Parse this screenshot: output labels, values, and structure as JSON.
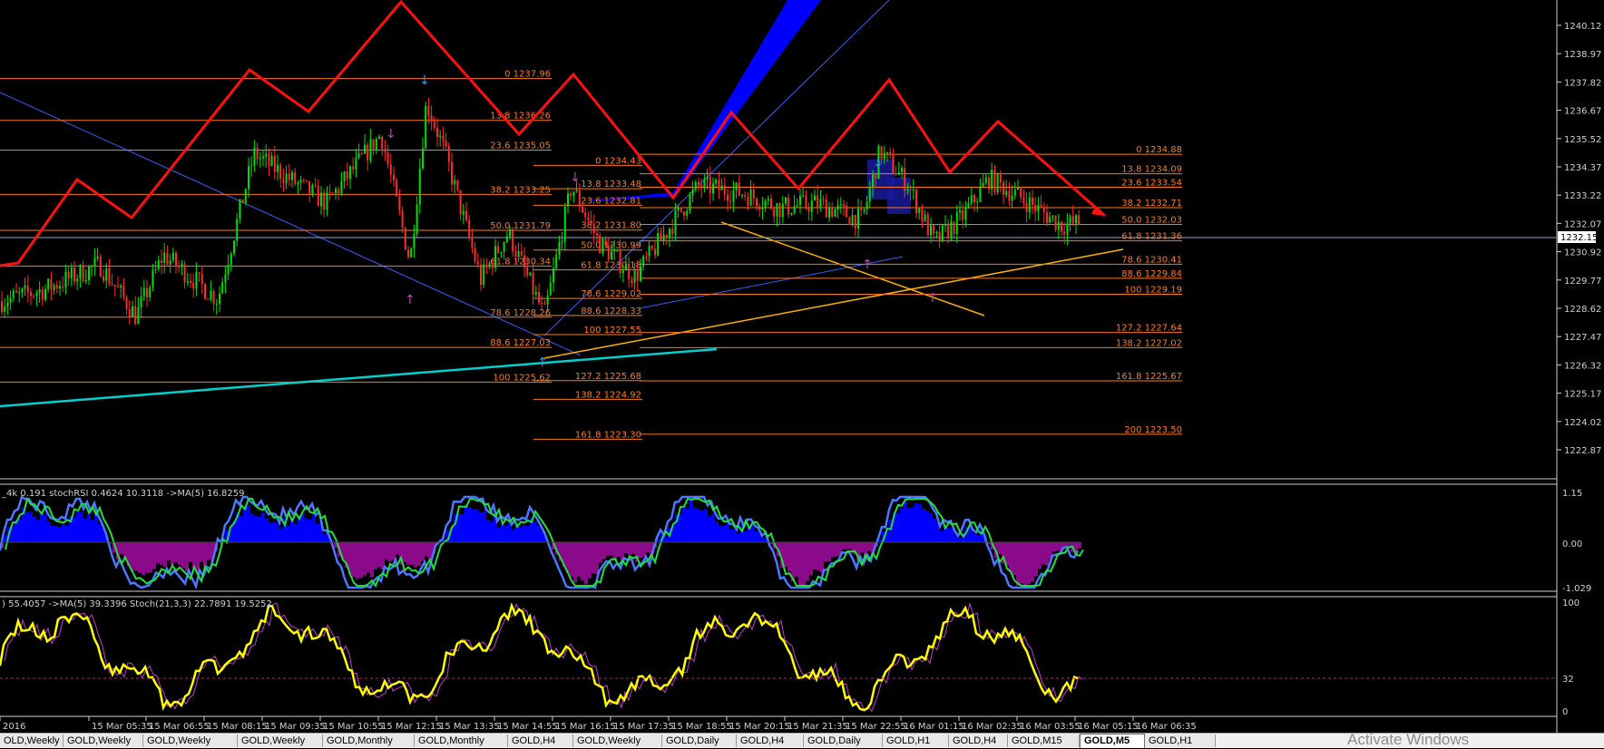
{
  "main_chart": {
    "price_ticks": [
      "1240.12",
      "1238.97",
      "1237.82",
      "1236.67",
      "1235.52",
      "1234.37",
      "1233.22",
      "1232.07",
      "1230.92",
      "1229.77",
      "1228.62",
      "1227.47",
      "1226.32",
      "1225.17",
      "1224.02",
      "1222.87"
    ],
    "current_price": "1232.15",
    "fib_left": [
      "0 1237.96",
      "13.8 1236.26",
      "23.6 1235.05",
      "38.2 1233.25",
      "50.0 1231.79",
      "61.8 1230.34",
      "78.6 1228.26",
      "88.6 1227.03",
      "100 1225.62"
    ],
    "fib_middle": [
      "0 1234.43",
      "13.8 1233.48",
      "23.6 1232.81",
      "38.2 1231.80",
      "50.0 1230.99",
      "61.8 1230.18",
      "78.6 1229.02",
      "88.6 1228.33",
      "100 1227.55",
      "127.2 1225.68",
      "138.2 1224.92",
      "161.8 1223.30"
    ],
    "fib_right": [
      "0 1234.88",
      "13.8 1234.09",
      "23.6 1233.54",
      "38.2 1232.71",
      "50.0 1232.03",
      "61.8 1231.36",
      "78.6 1230.41",
      "88.6 1229.84",
      "100 1229.19",
      "127.2 1227.64",
      "138.2 1227.02",
      "161.8 1225.67",
      "200 1223.50"
    ]
  },
  "indicator1": {
    "label": "_4k 0.191  stochRSI 0.4624 10.3118  ->MA(5) 16.8259",
    "ticks": [
      "1.15",
      "0.00",
      "-1.029"
    ]
  },
  "indicator2": {
    "label": ") 55.4057  ->MA(5) 39.3396  Stoch(21,3,3) 22.7891 19.5252",
    "ticks": [
      "100",
      "32",
      "0"
    ]
  },
  "time_axis": [
    "2016",
    "15 Mar 05:35",
    "15 Mar 06:55",
    "15 Mar 08:15",
    "15 Mar 09:35",
    "15 Mar 10:55",
    "15 Mar 12:15",
    "15 Mar 13:35",
    "15 Mar 14:55",
    "15 Mar 16:15",
    "15 Mar 17:35",
    "15 Mar 18:55",
    "15 Mar 20:15",
    "15 Mar 21:35",
    "15 Mar 22:55",
    "16 Mar 01:15",
    "16 Mar 02:35",
    "16 Mar 03:55",
    "16 Mar 05:15",
    "16 Mar 06:35"
  ],
  "tabs": [
    {
      "label": "OLD,Weekly",
      "active": false
    },
    {
      "label": "GOLD,Weekly",
      "active": false
    },
    {
      "label": "GOLD,Weekly",
      "active": false
    },
    {
      "label": "GOLD,Weekly",
      "active": false
    },
    {
      "label": "GOLD,Monthly",
      "active": false
    },
    {
      "label": "GOLD,Monthly",
      "active": false
    },
    {
      "label": "GOLD,H4",
      "active": false
    },
    {
      "label": "GOLD,Weekly",
      "active": false
    },
    {
      "label": "GOLD,Daily",
      "active": false
    },
    {
      "label": "GOLD,H4",
      "active": false
    },
    {
      "label": "GOLD,Daily",
      "active": false
    },
    {
      "label": "GOLD,H1",
      "active": false
    },
    {
      "label": "GOLD,H4",
      "active": false
    },
    {
      "label": "GOLD,M15",
      "active": false
    },
    {
      "label": "GOLD,M5",
      "active": true
    },
    {
      "label": "GOLD,H1",
      "active": false
    }
  ],
  "watermark": "Activate Windows",
  "colors": {
    "up": "#00e000",
    "down": "#ff2a2a",
    "fib": "#ff7a1a",
    "zigzag": "#ff1010",
    "channel": "#0000ff",
    "trend": "#ffb000",
    "cyan": "#00c8c8",
    "stoch": "#ffff00"
  }
}
